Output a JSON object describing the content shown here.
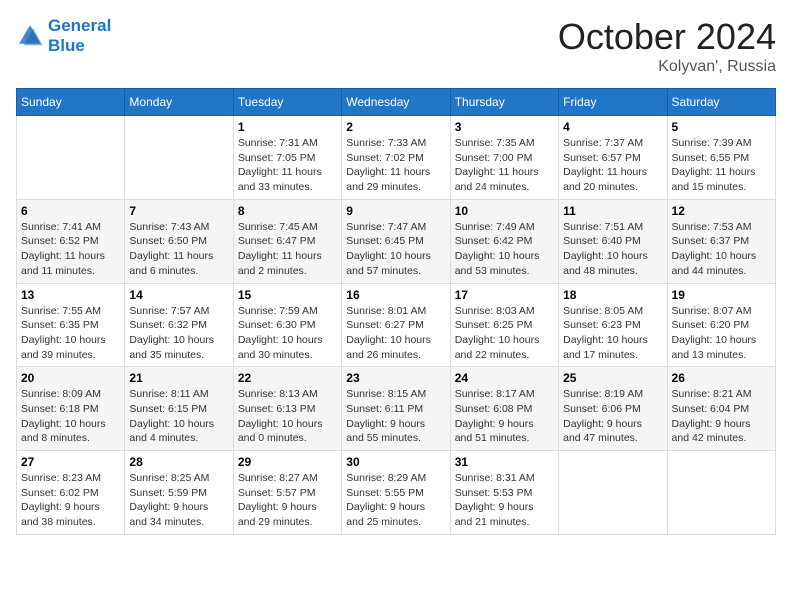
{
  "header": {
    "logo_line1": "General",
    "logo_line2": "Blue",
    "month": "October 2024",
    "location": "Kolyvan', Russia"
  },
  "days_of_week": [
    "Sunday",
    "Monday",
    "Tuesday",
    "Wednesday",
    "Thursday",
    "Friday",
    "Saturday"
  ],
  "weeks": [
    [
      {
        "day": "",
        "info": ""
      },
      {
        "day": "",
        "info": ""
      },
      {
        "day": "1",
        "info": "Sunrise: 7:31 AM\nSunset: 7:05 PM\nDaylight: 11 hours\nand 33 minutes."
      },
      {
        "day": "2",
        "info": "Sunrise: 7:33 AM\nSunset: 7:02 PM\nDaylight: 11 hours\nand 29 minutes."
      },
      {
        "day": "3",
        "info": "Sunrise: 7:35 AM\nSunset: 7:00 PM\nDaylight: 11 hours\nand 24 minutes."
      },
      {
        "day": "4",
        "info": "Sunrise: 7:37 AM\nSunset: 6:57 PM\nDaylight: 11 hours\nand 20 minutes."
      },
      {
        "day": "5",
        "info": "Sunrise: 7:39 AM\nSunset: 6:55 PM\nDaylight: 11 hours\nand 15 minutes."
      }
    ],
    [
      {
        "day": "6",
        "info": "Sunrise: 7:41 AM\nSunset: 6:52 PM\nDaylight: 11 hours\nand 11 minutes."
      },
      {
        "day": "7",
        "info": "Sunrise: 7:43 AM\nSunset: 6:50 PM\nDaylight: 11 hours\nand 6 minutes."
      },
      {
        "day": "8",
        "info": "Sunrise: 7:45 AM\nSunset: 6:47 PM\nDaylight: 11 hours\nand 2 minutes."
      },
      {
        "day": "9",
        "info": "Sunrise: 7:47 AM\nSunset: 6:45 PM\nDaylight: 10 hours\nand 57 minutes."
      },
      {
        "day": "10",
        "info": "Sunrise: 7:49 AM\nSunset: 6:42 PM\nDaylight: 10 hours\nand 53 minutes."
      },
      {
        "day": "11",
        "info": "Sunrise: 7:51 AM\nSunset: 6:40 PM\nDaylight: 10 hours\nand 48 minutes."
      },
      {
        "day": "12",
        "info": "Sunrise: 7:53 AM\nSunset: 6:37 PM\nDaylight: 10 hours\nand 44 minutes."
      }
    ],
    [
      {
        "day": "13",
        "info": "Sunrise: 7:55 AM\nSunset: 6:35 PM\nDaylight: 10 hours\nand 39 minutes."
      },
      {
        "day": "14",
        "info": "Sunrise: 7:57 AM\nSunset: 6:32 PM\nDaylight: 10 hours\nand 35 minutes."
      },
      {
        "day": "15",
        "info": "Sunrise: 7:59 AM\nSunset: 6:30 PM\nDaylight: 10 hours\nand 30 minutes."
      },
      {
        "day": "16",
        "info": "Sunrise: 8:01 AM\nSunset: 6:27 PM\nDaylight: 10 hours\nand 26 minutes."
      },
      {
        "day": "17",
        "info": "Sunrise: 8:03 AM\nSunset: 6:25 PM\nDaylight: 10 hours\nand 22 minutes."
      },
      {
        "day": "18",
        "info": "Sunrise: 8:05 AM\nSunset: 6:23 PM\nDaylight: 10 hours\nand 17 minutes."
      },
      {
        "day": "19",
        "info": "Sunrise: 8:07 AM\nSunset: 6:20 PM\nDaylight: 10 hours\nand 13 minutes."
      }
    ],
    [
      {
        "day": "20",
        "info": "Sunrise: 8:09 AM\nSunset: 6:18 PM\nDaylight: 10 hours\nand 8 minutes."
      },
      {
        "day": "21",
        "info": "Sunrise: 8:11 AM\nSunset: 6:15 PM\nDaylight: 10 hours\nand 4 minutes."
      },
      {
        "day": "22",
        "info": "Sunrise: 8:13 AM\nSunset: 6:13 PM\nDaylight: 10 hours\nand 0 minutes."
      },
      {
        "day": "23",
        "info": "Sunrise: 8:15 AM\nSunset: 6:11 PM\nDaylight: 9 hours\nand 55 minutes."
      },
      {
        "day": "24",
        "info": "Sunrise: 8:17 AM\nSunset: 6:08 PM\nDaylight: 9 hours\nand 51 minutes."
      },
      {
        "day": "25",
        "info": "Sunrise: 8:19 AM\nSunset: 6:06 PM\nDaylight: 9 hours\nand 47 minutes."
      },
      {
        "day": "26",
        "info": "Sunrise: 8:21 AM\nSunset: 6:04 PM\nDaylight: 9 hours\nand 42 minutes."
      }
    ],
    [
      {
        "day": "27",
        "info": "Sunrise: 8:23 AM\nSunset: 6:02 PM\nDaylight: 9 hours\nand 38 minutes."
      },
      {
        "day": "28",
        "info": "Sunrise: 8:25 AM\nSunset: 5:59 PM\nDaylight: 9 hours\nand 34 minutes."
      },
      {
        "day": "29",
        "info": "Sunrise: 8:27 AM\nSunset: 5:57 PM\nDaylight: 9 hours\nand 29 minutes."
      },
      {
        "day": "30",
        "info": "Sunrise: 8:29 AM\nSunset: 5:55 PM\nDaylight: 9 hours\nand 25 minutes."
      },
      {
        "day": "31",
        "info": "Sunrise: 8:31 AM\nSunset: 5:53 PM\nDaylight: 9 hours\nand 21 minutes."
      },
      {
        "day": "",
        "info": ""
      },
      {
        "day": "",
        "info": ""
      }
    ]
  ]
}
